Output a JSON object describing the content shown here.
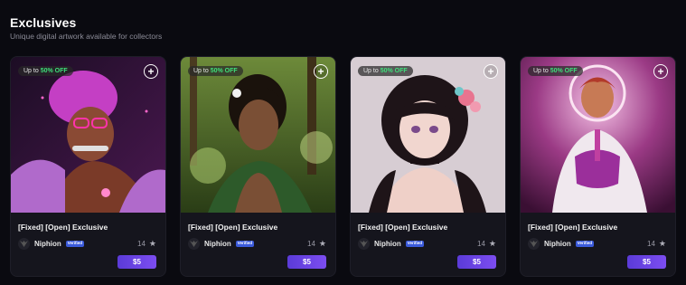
{
  "section": {
    "title": "Exclusives",
    "subtitle": "Unique digital artwork available for collectors"
  },
  "cards": [
    {
      "badge_prefix": "Up to ",
      "badge_discount": "50% OFF",
      "title": "[Fixed] [Open] Exclusive",
      "creator": "Niphion",
      "verified_label": "Verified",
      "likes": "14",
      "price": "$5",
      "art_colors": [
        "#2b1430",
        "#c74bd0",
        "#5a1f5e"
      ]
    },
    {
      "badge_prefix": "Up to ",
      "badge_discount": "50% OFF",
      "title": "[Fixed] [Open] Exclusive",
      "creator": "Niphion",
      "verified_label": "Verified",
      "likes": "14",
      "price": "$5",
      "art_colors": [
        "#2f4a1e",
        "#7da14a",
        "#1a2b12"
      ]
    },
    {
      "badge_prefix": "Up to ",
      "badge_discount": "50% OFF",
      "title": "[Fixed] [Open] Exclusive",
      "creator": "Niphion",
      "verified_label": "Verified",
      "likes": "14",
      "price": "$5",
      "art_colors": [
        "#d9cfd6",
        "#2a1a1e",
        "#e07b9a"
      ]
    },
    {
      "badge_prefix": "Up to ",
      "badge_discount": "50% OFF",
      "title": "[Fixed] [Open] Exclusive",
      "creator": "Niphion",
      "verified_label": "Verified",
      "likes": "14",
      "price": "$5",
      "art_colors": [
        "#7a2a6a",
        "#e0a9d5",
        "#3a0f33"
      ]
    }
  ]
}
